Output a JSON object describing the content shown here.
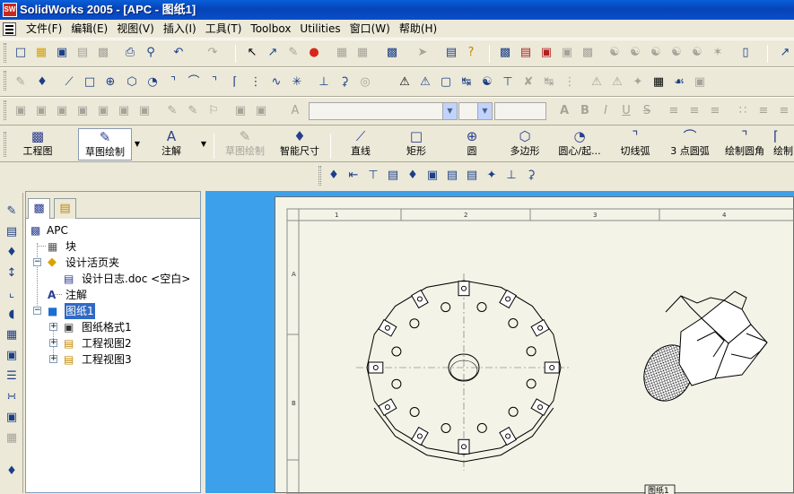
{
  "window": {
    "title": "SolidWorks 2005 - [APC - 图纸1]",
    "app_icon_text": "SW"
  },
  "menu": {
    "items": [
      "文件(F)",
      "编辑(E)",
      "视图(V)",
      "插入(I)",
      "工具(T)",
      "Toolbox",
      "Utilities",
      "窗口(W)",
      "帮助(H)"
    ]
  },
  "command_manager": {
    "buttons": [
      {
        "label": "工程图",
        "icon": "drawing-icon"
      },
      {
        "label": "草图绘制",
        "icon": "sketch-icon"
      },
      {
        "label": "注解",
        "icon": "annotation-icon"
      },
      {
        "label": "草图绘制",
        "icon": "sketch-mode-icon"
      },
      {
        "label": "智能尺寸",
        "icon": "smart-dimension-icon"
      },
      {
        "label": "直线",
        "icon": "line-icon"
      },
      {
        "label": "矩形",
        "icon": "rectangle-icon"
      },
      {
        "label": "圆",
        "icon": "circle-icon"
      },
      {
        "label": "多边形",
        "icon": "polygon-icon"
      },
      {
        "label": "圆心/起...",
        "icon": "centerpoint-arc-icon"
      },
      {
        "label": "切线弧",
        "icon": "tangent-arc-icon"
      },
      {
        "label": "3 点圆弧",
        "icon": "three-point-arc-icon"
      },
      {
        "label": "绘制圆角",
        "icon": "sketch-fillet-icon"
      },
      {
        "label": "绘制",
        "icon": "sketch-chamfer-icon"
      }
    ]
  },
  "feature_tree": {
    "root": "APC",
    "items": [
      {
        "label": "块",
        "icon": "block-icon"
      },
      {
        "label": "设计活页夹",
        "icon": "design-binder-icon"
      },
      {
        "label": "设计日志.doc <空白>",
        "icon": "word-doc-icon"
      },
      {
        "label": "注解",
        "icon": "annotations-icon"
      },
      {
        "label": "图纸1",
        "icon": "sheet-icon"
      },
      {
        "label": "图纸格式1",
        "icon": "sheet-format-icon"
      },
      {
        "label": "工程视图2",
        "icon": "drawing-view-icon"
      },
      {
        "label": "工程视图3",
        "icon": "drawing-view-icon"
      }
    ]
  },
  "sheet": {
    "column_labels": [
      "1",
      "2",
      "3",
      "4"
    ],
    "row_labels": [
      "A",
      "B"
    ],
    "tab_label": "图纸1"
  },
  "colors": {
    "title_bar": "#0a5fd8",
    "graphics_background": "#3ca1ea",
    "sheet_paper": "#f3f4e7",
    "selection": "#316ac5"
  }
}
